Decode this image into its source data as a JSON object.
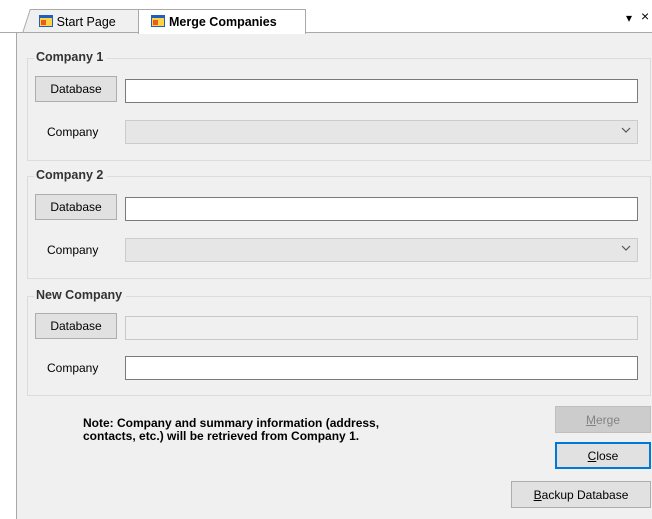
{
  "tabs": [
    {
      "label": "Start Page",
      "active": false
    },
    {
      "label": "Merge Companies",
      "active": true
    }
  ],
  "tab_controls": {
    "dropdown": "▾",
    "close": "×"
  },
  "company1": {
    "title": "Company 1",
    "database_button": "Database",
    "database_value": "",
    "company_label": "Company",
    "company_value": ""
  },
  "company2": {
    "title": "Company 2",
    "database_button": "Database",
    "database_value": "",
    "company_label": "Company",
    "company_value": ""
  },
  "new_company": {
    "title": "New Company",
    "database_button": "Database",
    "database_value": "",
    "company_label": "Company",
    "company_value": ""
  },
  "note": {
    "line1": "Note: Company and summary information (address,",
    "line2": "contacts, etc.) will be retrieved from Company 1."
  },
  "actions": {
    "merge": {
      "mnemonic": "M",
      "rest": "erge",
      "enabled": false
    },
    "close": {
      "mnemonic": "C",
      "rest": "lose",
      "enabled": true
    },
    "backup": {
      "mnemonic": "B",
      "rest": "ackup Database",
      "enabled": true
    }
  },
  "colors": {
    "panel": "#f0f0f0",
    "focus_border": "#0078d7",
    "disabled_text": "#838383"
  }
}
